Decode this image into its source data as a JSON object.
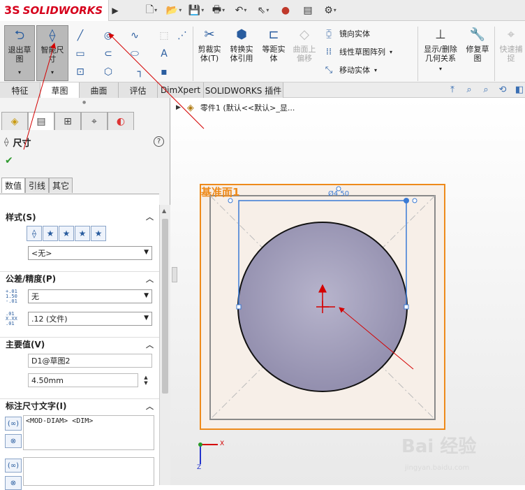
{
  "app": {
    "logo_mark": "3S",
    "logo_text": "SOLIDWORKS"
  },
  "quick_access": [
    {
      "name": "new-icon",
      "glyph": "🗋"
    },
    {
      "name": "open-icon",
      "glyph": "📂"
    },
    {
      "name": "save-icon",
      "glyph": "💾"
    },
    {
      "name": "print-icon",
      "glyph": "🖶"
    },
    {
      "name": "undo-icon",
      "glyph": "↶"
    },
    {
      "name": "select-icon",
      "glyph": "⇖"
    },
    {
      "name": "traffic-light-icon",
      "glyph": "●"
    },
    {
      "name": "file-props-icon",
      "glyph": "▤"
    },
    {
      "name": "options-gear-icon",
      "glyph": "⚙"
    }
  ],
  "ribbon": {
    "exit_sketch": "退出草\n图",
    "smart_dim": "智能尺\n寸",
    "trim": "剪裁实\n体(T)",
    "convert": "转换实\n体引用",
    "offset": "等距实\n体",
    "offset_surface": "曲面上\n偏移",
    "mirror": "镜向实体",
    "linear_pattern": "线性草图阵列",
    "move": "移动实体",
    "relations": "显示/删除\n几何关系",
    "repair": "修复草\n图",
    "quick_snap": "快速捕\n捉"
  },
  "tabs": [
    "特征",
    "草图",
    "曲面",
    "评估",
    "DimXpert",
    "SOLIDWORKS 插件"
  ],
  "active_tab": "草图",
  "tree": {
    "item": "零件1  (默认<<默认>_显..."
  },
  "panel": {
    "title": "尺寸",
    "help": "?",
    "subtabs": [
      "数值",
      "引线",
      "其它"
    ],
    "style_header": "样式(S)",
    "style_value": "<无>",
    "tolerance_header": "公差/精度(P)",
    "tolerance_value": "无",
    "precision_value": ".12 (文件)",
    "primary_header": "主要值(V)",
    "primary_name": "D1@草图2",
    "primary_value": "4.50mm",
    "text_header": "标注尺寸文字(I)",
    "dim_text": "<MOD-DIAM> <DIM>"
  },
  "canvas": {
    "plane_label": "基准面1",
    "dim_label": "Ø4.50",
    "watermark": "Bai 经验",
    "watermark_url": "jingyan.baidu.com",
    "axis_x": "X",
    "axis_z": "Z"
  },
  "colors": {
    "accent": "#2a5d9f",
    "plane": "#ee8a1a",
    "sketch": "#3a7ad5",
    "circle_fill": "#9f9bbb"
  }
}
